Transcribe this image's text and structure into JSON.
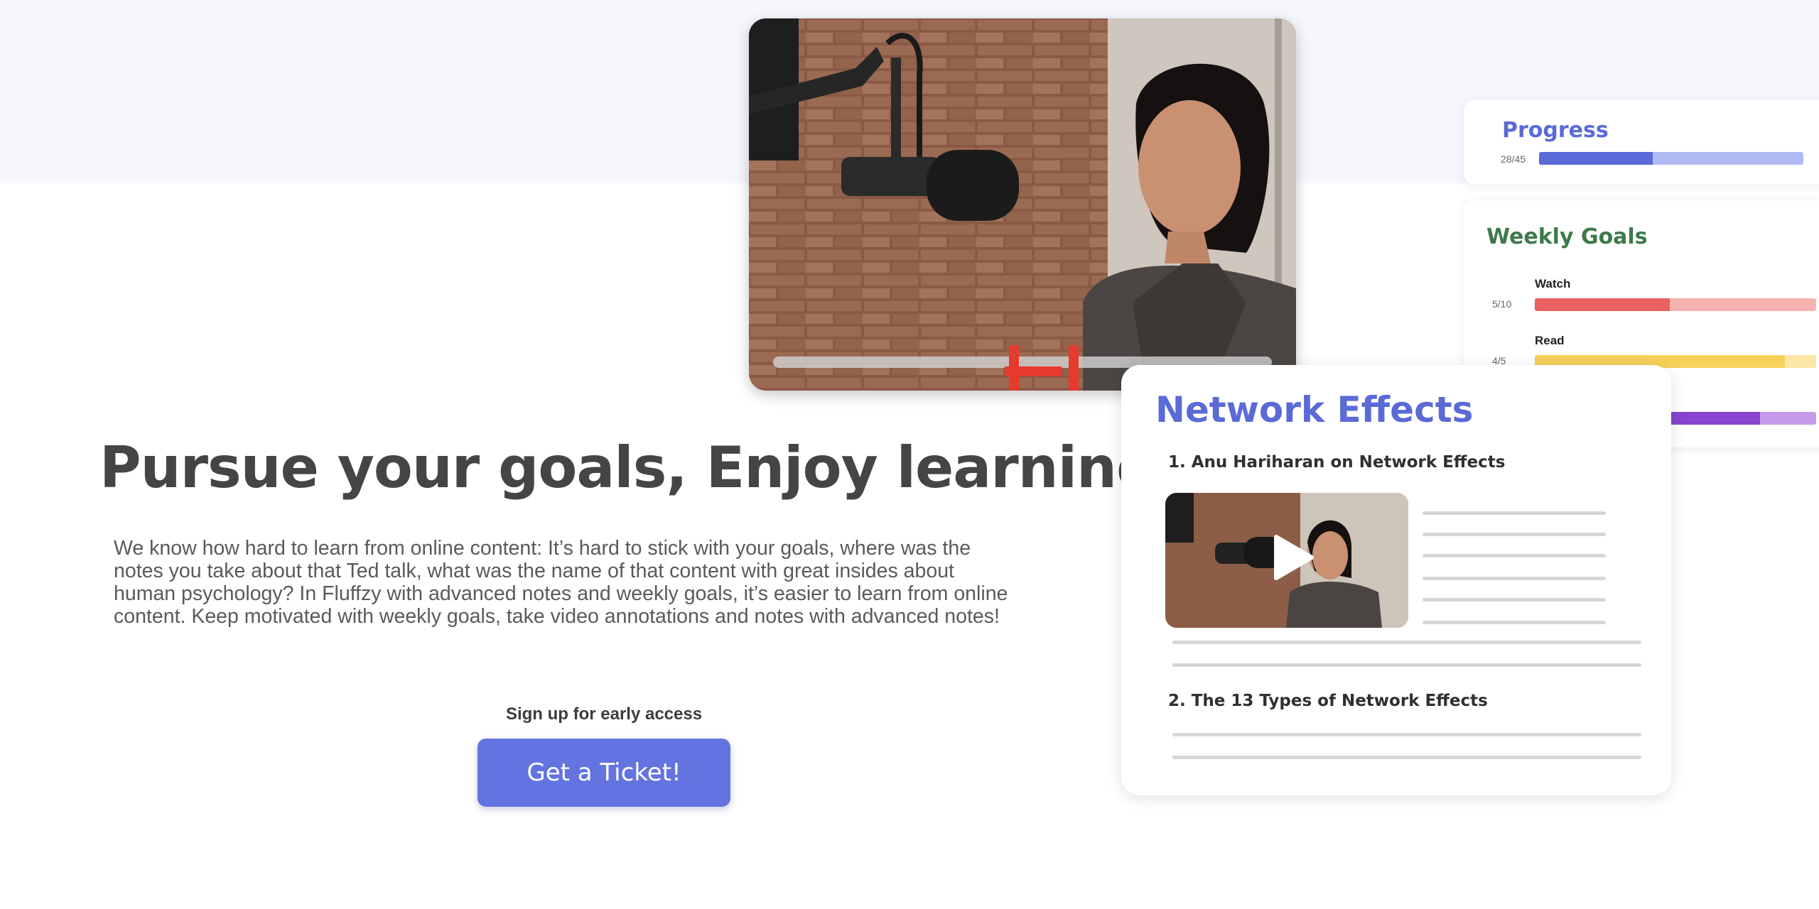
{
  "hero": {
    "headline": "Pursue your goals, Enjoy learning",
    "body": "We know how hard to learn from online content: It’s hard to stick with your goals, where was the notes you take about that Ted talk, what was the name of that content with great insides about human psychology? In Fluffzy with advanced notes and weekly goals, it’s easier to learn from online content. Keep motivated with weekly goals, take video annotations and notes with advanced notes!",
    "cta_label": "Sign up for early access",
    "cta_button": "Get a Ticket!"
  },
  "progress": {
    "title": "Progress",
    "count": "28/45",
    "fraction": 0.43
  },
  "weekly_goals": {
    "title": "Weekly Goals",
    "items": [
      {
        "label": "Watch",
        "count": "5/10",
        "fraction": 0.48,
        "color": "#ea5f5f",
        "track": "#f4b3b0"
      },
      {
        "label": "Read",
        "count": "4/5",
        "fraction": 0.89,
        "color": "#f7d15a",
        "track": "#fbe6a6"
      },
      {
        "label": "",
        "count": "",
        "fraction": 0.8,
        "color": "#8744cf",
        "track": "#c59ae9"
      }
    ]
  },
  "network_effects": {
    "title": "Network Effects",
    "items": [
      "1. Anu Hariharan on Network Effects",
      "2. The 13 Types of Network Effects"
    ]
  },
  "colors": {
    "accent": "#6373e0",
    "headline": "#454545",
    "goals_title": "#3e7a4a",
    "clip_marker": "#e53a2e"
  }
}
